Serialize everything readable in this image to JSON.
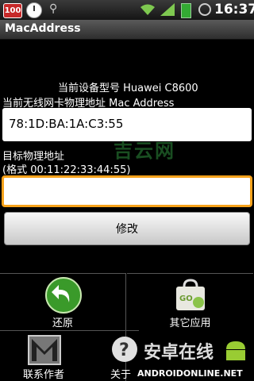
{
  "statusbar": {
    "badge": "100",
    "time": "16:37",
    "icons": [
      "app-badge-icon",
      "clock-icon",
      "usb-icon",
      "wifi-icon",
      "signal-icon",
      "battery-icon",
      "alarm-icon"
    ]
  },
  "app": {
    "title": "MacAddress"
  },
  "device": {
    "model_label": "当前设备型号 Huawei C8600"
  },
  "current_mac": {
    "label": "当前无线网卡物理地址 Mac Address",
    "value": "78:1D:BA:1A:C3:55"
  },
  "target": {
    "label": "目标物理地址",
    "format_hint": "(格式 00:11:22:33:44:55)",
    "value": "",
    "placeholder": ""
  },
  "modify_button": {
    "label": "修改"
  },
  "watermark": {
    "text": "吉云网"
  },
  "grid": {
    "restore": {
      "label": "还原",
      "icon": "restore-arrow-icon"
    },
    "other_apps": {
      "label": "其它应用",
      "icon": "go-market-icon"
    },
    "contact": {
      "label": "联系作者",
      "icon": "gmail-icon"
    },
    "about": {
      "label": "关于",
      "icon": "help-icon"
    }
  },
  "site_watermark": {
    "logo_text": "安卓在线",
    "url": "ANDROIDONLINE.NET"
  },
  "colors": {
    "input_focus": "#f7a21b",
    "restore_green": "#3a9a2a",
    "watermark_green": "#2e8c3c"
  }
}
